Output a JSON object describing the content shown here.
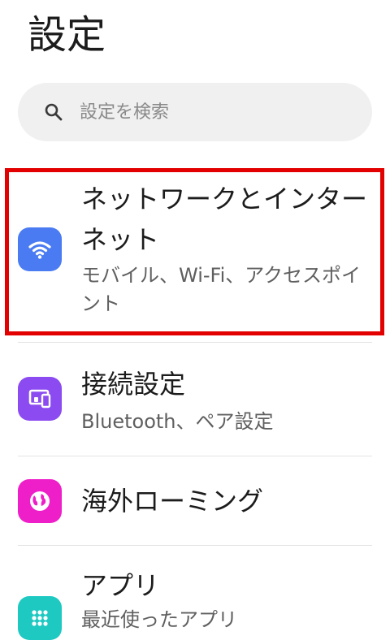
{
  "header": {
    "title": "設定"
  },
  "search": {
    "placeholder": "設定を検索",
    "icon": "search-icon"
  },
  "items": [
    {
      "title": "ネットワークとインターネット",
      "subtitle": "モバイル、Wi-Fi、アクセスポイント",
      "icon": "wifi-icon",
      "color": "#4a7bf2",
      "highlighted": true
    },
    {
      "title": "接続設定",
      "subtitle": "Bluetooth、ペア設定",
      "icon": "devices-icon",
      "color": "#8b4bf0"
    },
    {
      "title": "海外ローミング",
      "subtitle": "",
      "icon": "globe-icon",
      "color": "#ee1ec8"
    },
    {
      "title": "アプリ",
      "subtitle": "最近使ったアプリ",
      "icon": "apps-grid-icon",
      "color": "#1ec9c2"
    }
  ],
  "highlight": {
    "color": "#e20000"
  }
}
